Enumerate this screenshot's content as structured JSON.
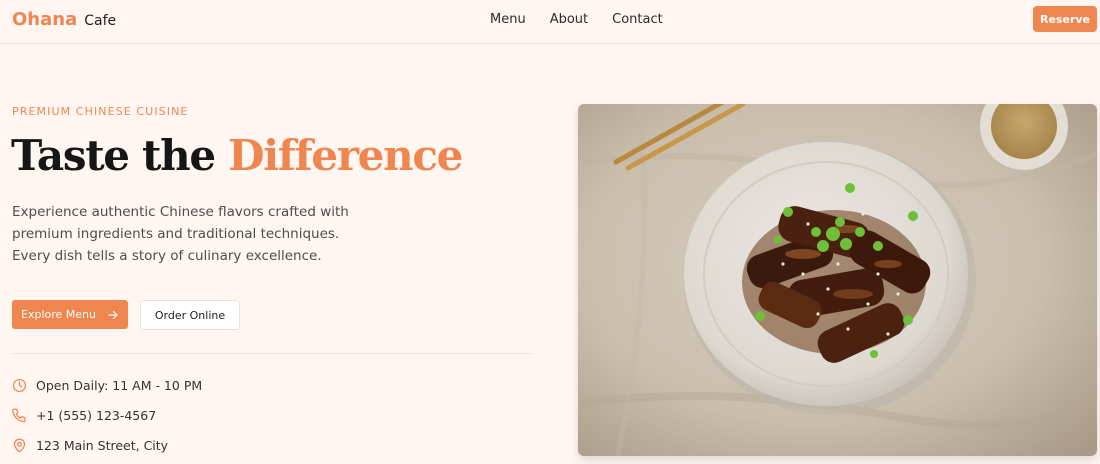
{
  "brand": {
    "primary": "Ohana",
    "secondary": "Cafe"
  },
  "nav": {
    "links": [
      "Menu",
      "About",
      "Contact"
    ],
    "reserve_label": "Reserve"
  },
  "hero": {
    "eyebrow": "PREMIUM CHINESE CUISINE",
    "headline_plain": "Taste the ",
    "headline_accent": "Difference",
    "lead_lines": [
      "Experience authentic Chinese flavors crafted with",
      "premium ingredients and traditional techniques.",
      "Every dish tells a story of culinary excellence."
    ],
    "primary_cta": "Explore Menu",
    "secondary_cta": "Order Online"
  },
  "info": {
    "hours": "Open Daily: 11 AM - 10 PM",
    "phone": "+1 (555) 123-4567",
    "address": "123 Main Street, City"
  },
  "icons": {
    "hours": "clock-icon",
    "phone": "phone-icon",
    "address": "map-pin-icon",
    "cta_arrow": "arrow-right-icon"
  },
  "colors": {
    "accent": "#ef8650",
    "background": "#fff5f1",
    "text": "#1a1a1a",
    "muted": "#4e4e4e"
  }
}
